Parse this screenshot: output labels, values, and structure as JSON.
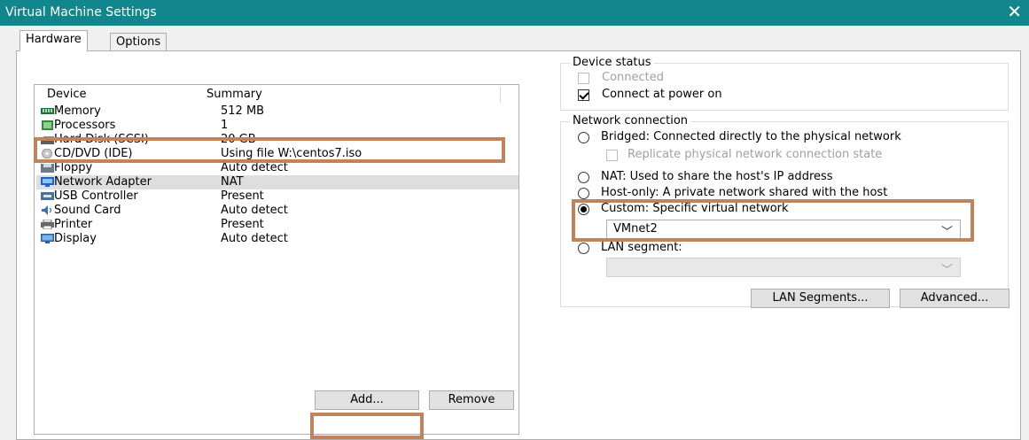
{
  "window": {
    "title": "Virtual Machine Settings",
    "close_glyph": "✕"
  },
  "tabs": [
    {
      "label": "Hardware",
      "active": true
    },
    {
      "label": "Options",
      "active": false
    }
  ],
  "device_list": {
    "headers": {
      "device": "Device",
      "summary": "Summary"
    },
    "rows": [
      {
        "device": "Memory",
        "summary": "512 MB",
        "icon": "memory-icon"
      },
      {
        "device": "Processors",
        "summary": "1",
        "icon": "processor-icon"
      },
      {
        "device": "Hard Disk (SCSI)",
        "summary": "20 GB",
        "icon": "hard-disk-icon"
      },
      {
        "device": "CD/DVD (IDE)",
        "summary": "Using file W:\\centos7.iso",
        "icon": "cd-dvd-icon"
      },
      {
        "device": "Floppy",
        "summary": "Auto detect",
        "icon": "floppy-icon"
      },
      {
        "device": "Network Adapter",
        "summary": "NAT",
        "icon": "network-adapter-icon",
        "selected": true
      },
      {
        "device": "USB Controller",
        "summary": "Present",
        "icon": "usb-icon"
      },
      {
        "device": "Sound Card",
        "summary": "Auto detect",
        "icon": "sound-card-icon"
      },
      {
        "device": "Printer",
        "summary": "Present",
        "icon": "printer-icon"
      },
      {
        "device": "Display",
        "summary": "Auto detect",
        "icon": "display-icon"
      }
    ]
  },
  "buttons": {
    "add": "Add...",
    "remove": "Remove",
    "lan_segments": "LAN Segments...",
    "advanced": "Advanced..."
  },
  "device_status": {
    "legend": "Device status",
    "connected": {
      "label": "Connected",
      "checked": false,
      "enabled": false
    },
    "connect_at_power_on": {
      "label": "Connect at power on",
      "checked": true,
      "enabled": true
    }
  },
  "network_connection": {
    "legend": "Network connection",
    "bridged": {
      "label": "Bridged: Connected directly to the physical network",
      "selected": false
    },
    "replicate": {
      "label": "Replicate physical network connection state",
      "checked": false,
      "enabled": false
    },
    "nat": {
      "label": "NAT: Used to share the host's IP address",
      "selected": false
    },
    "host_only": {
      "label": "Host-only: A private network shared with the host",
      "selected": false
    },
    "custom": {
      "label": "Custom: Specific virtual network",
      "selected": true
    },
    "custom_value": "VMnet2",
    "lan_segment": {
      "label": "LAN segment:",
      "selected": false
    },
    "lan_segment_value": ""
  },
  "colors": {
    "titlebar": "#11868c",
    "highlight": "#c1835c",
    "selection": "#dedede"
  }
}
